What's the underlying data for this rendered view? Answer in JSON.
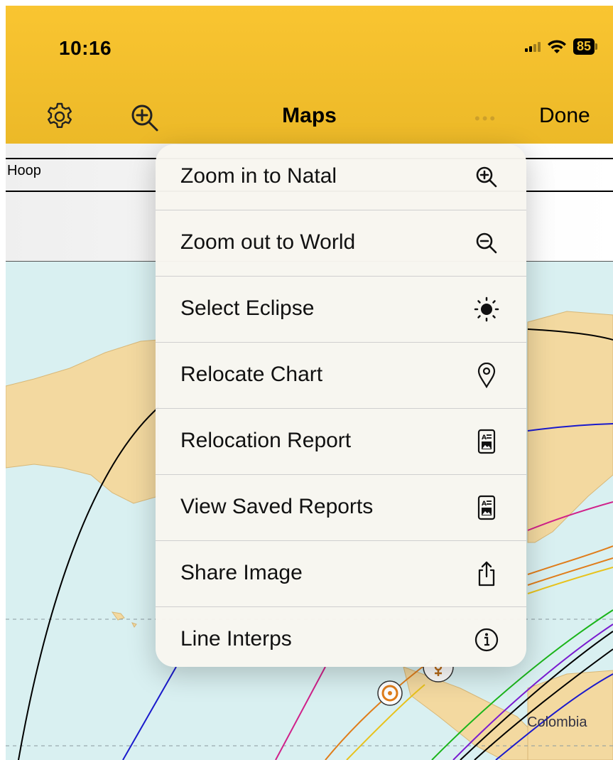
{
  "status": {
    "time": "10:16",
    "battery": "85"
  },
  "nav": {
    "title": "Maps",
    "done_label": "Done",
    "more": "•••"
  },
  "chart_panel": {
    "name": "Hoop"
  },
  "map": {
    "labels": [
      "Colombia"
    ]
  },
  "menu": {
    "items": [
      {
        "label": "Zoom in to Natal",
        "icon": "zoom-in-icon"
      },
      {
        "label": "Zoom out to World",
        "icon": "zoom-out-icon"
      },
      {
        "label": "Select Eclipse",
        "icon": "sun-icon"
      },
      {
        "label": "Relocate Chart",
        "icon": "map-pin-icon"
      },
      {
        "label": "Relocation Report",
        "icon": "report-icon"
      },
      {
        "label": "View Saved Reports",
        "icon": "report-icon"
      },
      {
        "label": "Share Image",
        "icon": "share-icon"
      },
      {
        "label": "Line Interps",
        "icon": "info-icon"
      }
    ]
  },
  "colors": {
    "header": "#f6c22e",
    "ocean": "#d9f0f1",
    "land": "#f3d9a0"
  }
}
